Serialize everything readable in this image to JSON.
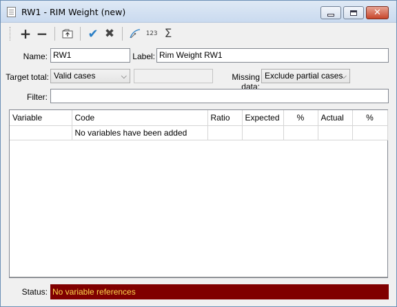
{
  "window": {
    "title": "RW1 - RIM Weight (new)",
    "icon": "document-icon",
    "buttons": {
      "minimize": "minimize-icon",
      "maximize": "maximize-icon",
      "close": "close-icon"
    }
  },
  "toolbar": {
    "add": "+",
    "remove": "−",
    "import_icon": "import-icon",
    "confirm": "✔",
    "cancel": "✖",
    "number_format": "123",
    "sum": "Σ"
  },
  "form": {
    "name_label": "Name:",
    "name_value": "RW1",
    "label_label": "Label:",
    "label_value": "Rim Weight RW1",
    "target_total_label": "Target total:",
    "target_total_value": "Valid cases",
    "target_total_extra": "",
    "missing_data_label": "Missing data:",
    "missing_data_value": "Exclude partial cases",
    "filter_label": "Filter:",
    "filter_value": ""
  },
  "grid": {
    "columns": [
      "Variable",
      "Code",
      "Ratio",
      "Expected",
      "%",
      "Actual",
      "%"
    ],
    "rows": [
      [
        "",
        "No variables have been added",
        "",
        "",
        "",
        "",
        ""
      ]
    ]
  },
  "status": {
    "label": "Status:",
    "text": "No variable references",
    "bg_color": "#800000",
    "text_color": "#ffd84d"
  }
}
